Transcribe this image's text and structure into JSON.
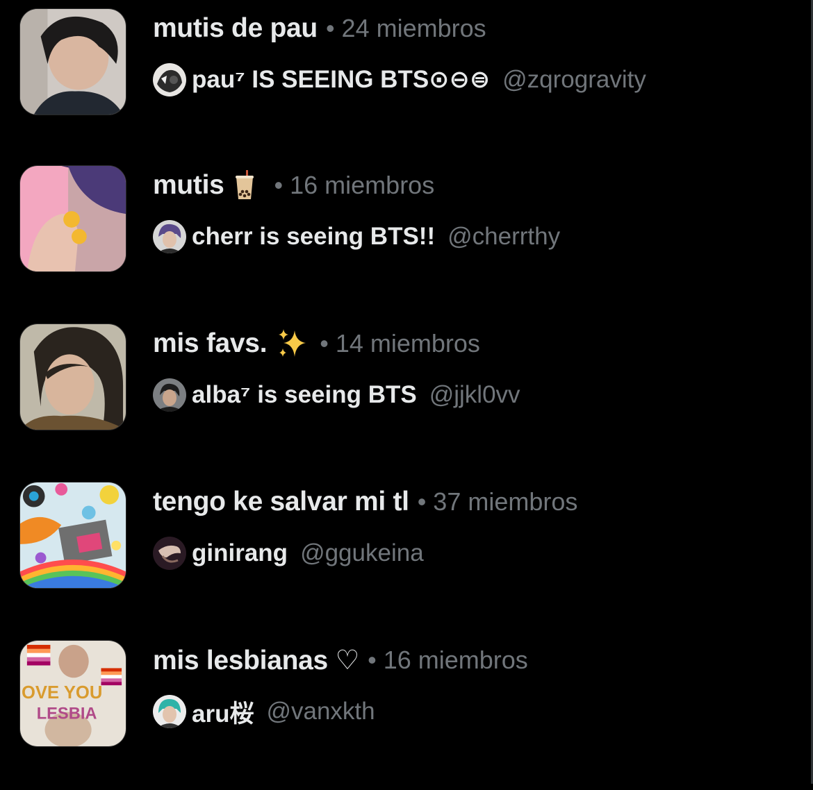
{
  "lists": [
    {
      "name": "mutis de pau",
      "name_emoji": "",
      "separator": "•",
      "members": "24 miembros",
      "owner_name": "pau⁷ IS SEEING BTS⊙⊖⊜",
      "owner_handle": "@zqrogravity"
    },
    {
      "name": "mutis",
      "name_emoji": "bubble-tea",
      "separator": "•",
      "members": "16 miembros",
      "owner_name": "cherr is seeing BTS!!",
      "owner_handle": "@cherrthy"
    },
    {
      "name": "mis favs.",
      "name_emoji": "✨",
      "separator": "•",
      "members": "14 miembros",
      "owner_name": "alba⁷ is seeing BTS",
      "owner_handle": "@jjkl0vv"
    },
    {
      "name": "tengo ke salvar mi tl",
      "name_emoji": "",
      "separator": "•",
      "members": "37 miembros",
      "owner_name": "ginirang",
      "owner_handle": "@ggukeina"
    },
    {
      "name": "mis lesbianas ♡",
      "name_emoji": "",
      "separator": "•",
      "members": "16 miembros",
      "owner_name": "aru桜",
      "owner_handle": "@vanxkth",
      "banner_text": [
        "OVE YOU",
        "LESBIA"
      ]
    }
  ],
  "colors": {
    "background": "#000000",
    "primary_text": "#e7e9ea",
    "secondary_text": "#71767b"
  }
}
